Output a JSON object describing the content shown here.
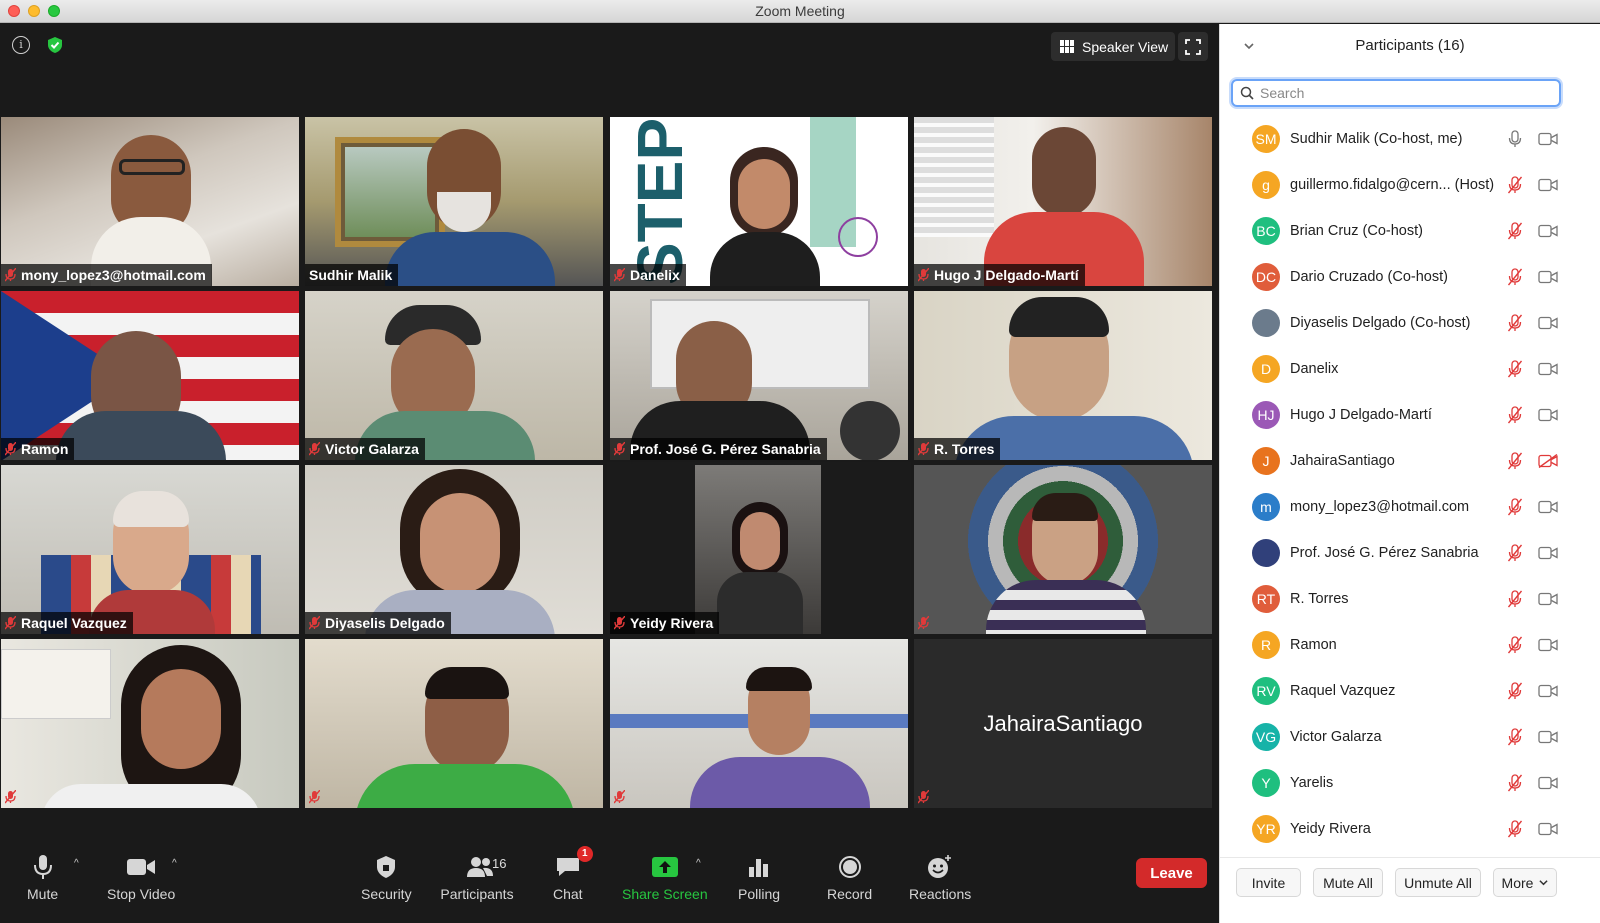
{
  "window": {
    "title": "Zoom Meeting"
  },
  "topbar": {
    "view_label": "Speaker View"
  },
  "tiles": [
    {
      "name": "mony_lopez3@hotmail.com",
      "muted": true
    },
    {
      "name": "Sudhir Malik",
      "muted": false
    },
    {
      "name": "Danelix",
      "muted": true
    },
    {
      "name": "Hugo J Delgado-Martí",
      "muted": true
    },
    {
      "name": "Ramon",
      "muted": true
    },
    {
      "name": "Victor Galarza",
      "muted": true
    },
    {
      "name": "Prof. José G. Pérez Sanabria",
      "muted": true
    },
    {
      "name": "R. Torres",
      "muted": true
    },
    {
      "name": "Raquel Vazquez",
      "muted": true
    },
    {
      "name": "Diyaselis Delgado",
      "muted": true
    },
    {
      "name": "Yeidy Rivera",
      "muted": true
    },
    {
      "name": "",
      "muted": true
    },
    {
      "name": "",
      "muted": true
    },
    {
      "name": "",
      "muted": true
    },
    {
      "name": "",
      "muted": true
    },
    {
      "name": "JahairaSantiago",
      "muted": true
    }
  ],
  "toolbar": {
    "mute": "Mute",
    "stop_video": "Stop Video",
    "security": "Security",
    "participants": "Participants",
    "participants_count": "16",
    "chat": "Chat",
    "chat_badge": "1",
    "share_screen": "Share Screen",
    "polling": "Polling",
    "record": "Record",
    "reactions": "Reactions",
    "leave": "Leave"
  },
  "panel": {
    "title": "Participants (16)",
    "search_placeholder": "Search",
    "participants": [
      {
        "initials": "SM",
        "name": "Sudhir Malik (Co-host, me)",
        "color": "#f5a623",
        "mic": "on",
        "cam": "on"
      },
      {
        "initials": "g",
        "name": "guillermo.fidalgo@cern... (Host)",
        "color": "#f5a623",
        "mic": "muted",
        "cam": "on"
      },
      {
        "initials": "BC",
        "name": "Brian Cruz (Co-host)",
        "color": "#1fbf7f",
        "mic": "muted",
        "cam": "on"
      },
      {
        "initials": "DC",
        "name": "Dario Cruzado (Co-host)",
        "color": "#e05d3b",
        "mic": "muted",
        "cam": "on"
      },
      {
        "initials": "",
        "name": "Diyaselis Delgado (Co-host)",
        "color": "#6b7b8c",
        "mic": "muted",
        "cam": "on"
      },
      {
        "initials": "D",
        "name": "Danelix",
        "color": "#f5a623",
        "mic": "muted",
        "cam": "on"
      },
      {
        "initials": "HJ",
        "name": "Hugo J Delgado-Martí",
        "color": "#9b59b6",
        "mic": "muted",
        "cam": "on"
      },
      {
        "initials": "J",
        "name": "JahairaSantiago",
        "color": "#e8731e",
        "mic": "muted",
        "cam": "off"
      },
      {
        "initials": "m",
        "name": "mony_lopez3@hotmail.com",
        "color": "#2b7dc9",
        "mic": "muted",
        "cam": "on"
      },
      {
        "initials": "",
        "name": "Prof. José G. Pérez Sanabria",
        "color": "#30407a",
        "mic": "muted",
        "cam": "on"
      },
      {
        "initials": "RT",
        "name": "R. Torres",
        "color": "#e05d3b",
        "mic": "muted",
        "cam": "on"
      },
      {
        "initials": "R",
        "name": "Ramon",
        "color": "#f5a623",
        "mic": "muted",
        "cam": "on"
      },
      {
        "initials": "RV",
        "name": "Raquel Vazquez",
        "color": "#1fbf7f",
        "mic": "muted",
        "cam": "on"
      },
      {
        "initials": "VG",
        "name": "Victor Galarza",
        "color": "#17b3a8",
        "mic": "muted",
        "cam": "on"
      },
      {
        "initials": "Y",
        "name": "Yarelis",
        "color": "#1fbf7f",
        "mic": "muted",
        "cam": "on"
      },
      {
        "initials": "YR",
        "name": "Yeidy Rivera",
        "color": "#f5a623",
        "mic": "muted",
        "cam": "on"
      }
    ],
    "footer": {
      "invite": "Invite",
      "mute_all": "Mute All",
      "unmute_all": "Unmute All",
      "more": "More"
    }
  },
  "colors": {
    "muted_red": "#e03a3a",
    "share_green": "#27c640",
    "leave_red": "#d32a2a",
    "active_speaker": "#e0e88a"
  }
}
